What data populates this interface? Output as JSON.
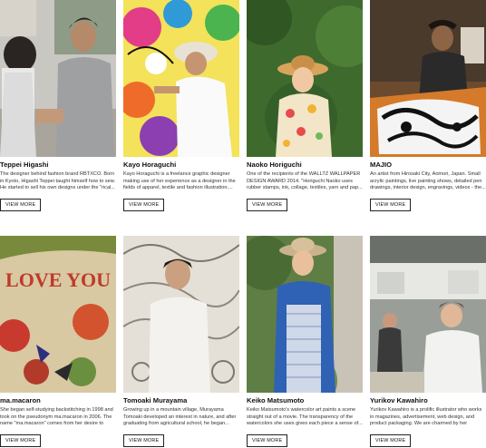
{
  "view_more_label": "VIEW MORE",
  "artists": [
    {
      "name": "Teppei Higashi",
      "desc": "The designer behind fashion brand RBTXCO. Born in Kyoto, Higashi Teppei taught himself how to sew. He started to sell his own designs under the \"rical..."
    },
    {
      "name": "Kayo Horaguchi",
      "desc": "Kayo Horaguchi is a freelance graphic designer making use of her experience as a designer in the fields of apparel, textile and fashion illustration...."
    },
    {
      "name": "Naoko Horiguchi",
      "desc": "One of the recipients of the WALLTZ WALLPAPER DESIGN AWARD 2014. \"Horiguchi Naoko uses rubber stamps, ink, collage, textiles, yarn and pap..."
    },
    {
      "name": "MAJIO",
      "desc": "An artist from Hirosaki City, Aomori, Japan. Small acrylic paintings, live painting shows, detailed pen drawings, interior design, engravings, videos - the..."
    },
    {
      "name": "ma.macaron",
      "desc": "She began self-studying backstitching in 1998 and took on the pseudonym ma.macaron in 2006. The name \"ma.macaron\" comes from her desire to live..."
    },
    {
      "name": "Tomoaki Murayama",
      "desc": "Growing up in a mountain village, Murayama Tomoaki developed an interest in nature, and after graduating from agricultural school, he began..."
    },
    {
      "name": "Keiko Matsumoto",
      "desc": "Keiko Matsumoto's watercolor art paints a scene straight out of a movie. The transparency of the watercolors she uses gives each piece a sense of..."
    },
    {
      "name": "Yurikov Kawahiro",
      "desc": "Yurikov Kawahiro is a prolific illustrator who works in magazines, advertisement, web design, and product packaging. We are charmed by her comica..."
    }
  ],
  "artwork_text": "LOVE YOU"
}
